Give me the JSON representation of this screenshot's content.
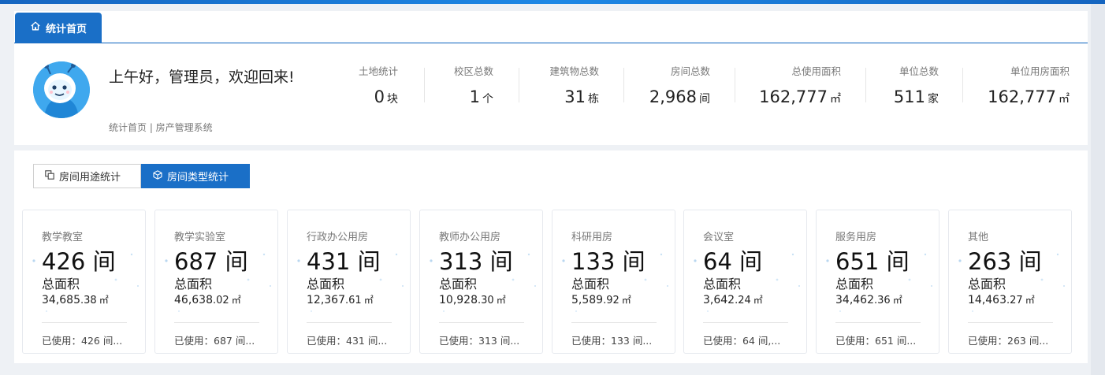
{
  "tab": {
    "label": "统计首页",
    "icon": "home-icon"
  },
  "welcome": {
    "greeting": "上午好，管理员，欢迎回来!",
    "breadcrumb": "统计首页 | 房产管理系统"
  },
  "stats": [
    {
      "label": "土地统计",
      "value": "0",
      "unit": "块"
    },
    {
      "label": "校区总数",
      "value": "1",
      "unit": "个"
    },
    {
      "label": "建筑物总数",
      "value": "31",
      "unit": "栋"
    },
    {
      "label": "房间总数",
      "value": "2,968",
      "unit": "间"
    },
    {
      "label": "总使用面积",
      "value": "162,777",
      "unit": "㎡"
    },
    {
      "label": "单位总数",
      "value": "511",
      "unit": "家"
    },
    {
      "label": "单位用房面积",
      "value": "162,777",
      "unit": "㎡"
    }
  ],
  "segments": [
    {
      "label": "房间用途统计",
      "icon": "copy-icon",
      "active": false
    },
    {
      "label": "房间类型统计",
      "icon": "cube-icon",
      "active": true
    }
  ],
  "cards": [
    {
      "name": "教学教室",
      "count": "426 间",
      "desc": "总面积",
      "area_int": "34,685",
      "area_dec": ".38",
      "unit": "㎡",
      "used": "已使用：426 间..."
    },
    {
      "name": "教学实验室",
      "count": "687 间",
      "desc": "总面积",
      "area_int": "46,638",
      "area_dec": ".02",
      "unit": "㎡",
      "used": "已使用：687 间..."
    },
    {
      "name": "行政办公用房",
      "count": "431 间",
      "desc": "总面积",
      "area_int": "12,367",
      "area_dec": ".61",
      "unit": "㎡",
      "used": "已使用：431 间..."
    },
    {
      "name": "教师办公用房",
      "count": "313 间",
      "desc": "总面积",
      "area_int": "10,928",
      "area_dec": ".30",
      "unit": "㎡",
      "used": "已使用：313 间..."
    },
    {
      "name": "科研用房",
      "count": "133 间",
      "desc": "总面积",
      "area_int": "5,589",
      "area_dec": ".92",
      "unit": "㎡",
      "used": "已使用：133 间..."
    },
    {
      "name": "会议室",
      "count": "64 间",
      "desc": "总面积",
      "area_int": "3,642",
      "area_dec": ".24",
      "unit": "㎡",
      "used": "已使用：64 间,..."
    },
    {
      "name": "服务用房",
      "count": "651 间",
      "desc": "总面积",
      "area_int": "34,462",
      "area_dec": ".36",
      "unit": "㎡",
      "used": "已使用：651 间..."
    },
    {
      "name": "其他",
      "count": "263 间",
      "desc": "总面积",
      "area_int": "14,463",
      "area_dec": ".27",
      "unit": "㎡",
      "used": "已使用：263 间..."
    }
  ],
  "colors": {
    "accent": "#1a6fc7",
    "background": "#eef1f5"
  }
}
